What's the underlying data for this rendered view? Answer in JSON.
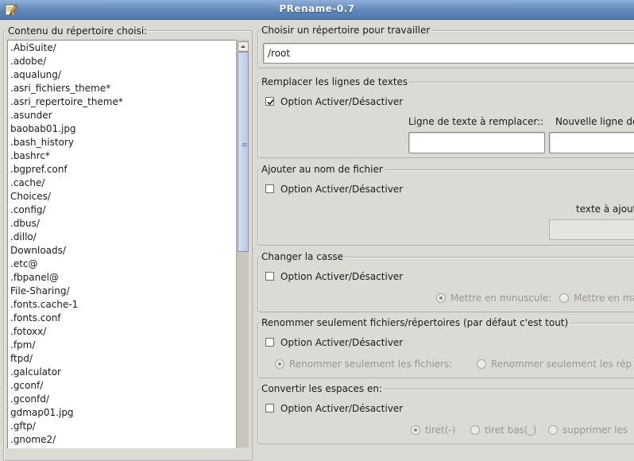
{
  "window": {
    "title": "PRename-0.7"
  },
  "left_panel": {
    "label": "Contenu du répertoire choisi:",
    "files": [
      ".AbiSuite/",
      ".adobe/",
      ".aqualung/",
      ".asri_fichiers_theme*",
      ".asri_repertoire_theme*",
      ".asunder",
      "baobab01.jpg",
      ".bash_history",
      ".bashrc*",
      ".bgpref.conf",
      ".cache/",
      "Choices/",
      ".config/",
      ".dbus/",
      ".dillo/",
      "Downloads/",
      ".etc@",
      ".fbpanel@",
      "File-Sharing/",
      ".fonts.cache-1",
      ".fonts.conf",
      ".fotoxx/",
      ".fpm/",
      "ftpd/",
      ".galculator",
      ".gconf/",
      ".gconfd/",
      "gdmap01.jpg",
      ".gftp/",
      ".gnome2/"
    ]
  },
  "directory": {
    "label": "Choisir un répertoire pour travailler",
    "value": "/root"
  },
  "replace_section": {
    "label": "Remplacer les lignes de textes",
    "toggle": "Option Activer/Désactiver",
    "checked": true,
    "old_text_label": "Ligne de texte à remplacer::",
    "new_text_label": "Nouvelle ligne de",
    "old_text_value": "",
    "new_text_value": ""
  },
  "add_section": {
    "label": "Ajouter au nom de fichier",
    "toggle": "Option Activer/Désactiver",
    "checked": false,
    "text_label": "texte à ajout",
    "text_value": ""
  },
  "case_section": {
    "label": "Changer la casse",
    "toggle": "Option Activer/Désactiver",
    "checked": false,
    "options": [
      "Mettre en minuscule:",
      "Mettre en ma"
    ],
    "selected": 0
  },
  "rename_section": {
    "label": "Renommer seulement fichiers/répertoires (par défaut c'est tout)",
    "toggle": "Option Activer/Désactiver",
    "checked": false,
    "options": [
      "Renommer seulement les fichiers:",
      "Renommer seulement les rép"
    ],
    "selected": 0
  },
  "spaces_section": {
    "label": "Convertir les espaces en:",
    "toggle": "Option Activer/Désactiver",
    "checked": false,
    "options": [
      "tiret(-)",
      "tiret bas(_)",
      "supprimer les"
    ],
    "selected": 0
  }
}
